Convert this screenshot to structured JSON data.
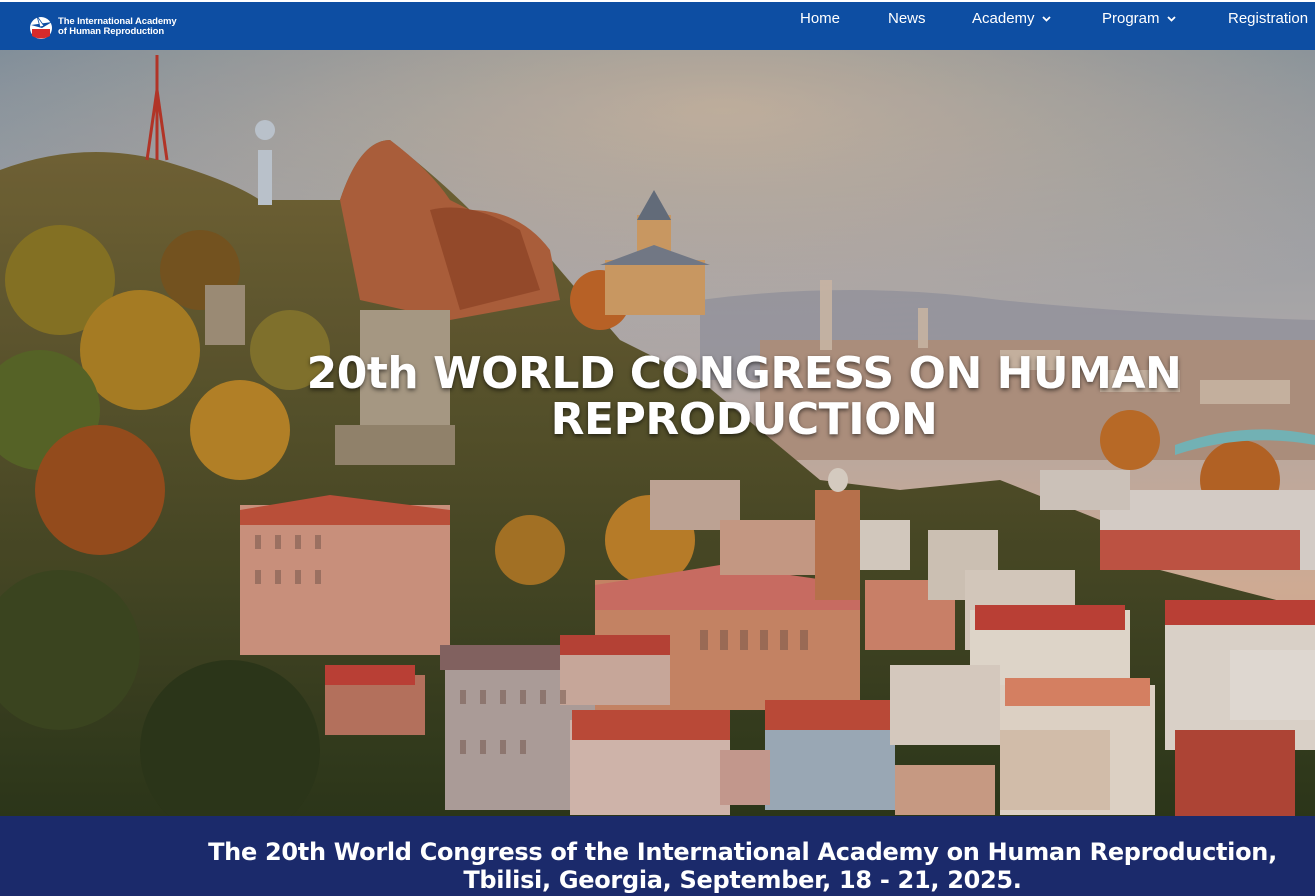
{
  "brand": {
    "name_line1": "The International Academy",
    "name_line2": "of Human Reproduction"
  },
  "nav": {
    "home": "Home",
    "news": "News",
    "academy": "Academy",
    "program": "Program",
    "registration": "Registration"
  },
  "hero": {
    "title_line1": "20th WORLD CONGRESS ON HUMAN",
    "title_line2": "REPRODUCTION"
  },
  "banner": {
    "text": "The 20th World Congress of the International Academy on Human Reproduction, Tbilisi, Georgia, September, 18 - 21, 2025."
  },
  "colors": {
    "navbar": "#0d4ea3",
    "banner": "#1b2a6b",
    "text": "#ffffff"
  }
}
